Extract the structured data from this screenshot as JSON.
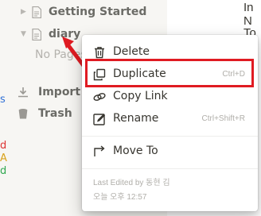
{
  "sidebar": {
    "tree": [
      {
        "label": "Getting Started",
        "expanded": false
      },
      {
        "label": "diary",
        "expanded": true
      }
    ],
    "empty_text": "No Pages",
    "bottom_items": [
      {
        "label": "Import",
        "icon": "download-icon"
      },
      {
        "label": "Trash",
        "icon": "trash-icon"
      }
    ]
  },
  "content": {
    "line1": "In N",
    "line2": "To c"
  },
  "context_menu": {
    "items": [
      {
        "label": "Delete",
        "icon": "trash-icon",
        "shortcut": ""
      },
      {
        "label": "Duplicate",
        "icon": "duplicate-icon",
        "shortcut": "Ctrl+D"
      },
      {
        "label": "Copy Link",
        "icon": "link-icon",
        "shortcut": ""
      },
      {
        "label": "Rename",
        "icon": "rename-icon",
        "shortcut": "Ctrl+Shift+R"
      },
      {
        "label": "Move To",
        "icon": "move-to-icon",
        "shortcut": ""
      }
    ],
    "last_edited_label": "Last Edited by 동현 김",
    "last_edited_time": "오늘 오후 12:57"
  },
  "colors": {
    "highlight": "#e01b22",
    "sidebar_bg": "#f7f6f3"
  }
}
